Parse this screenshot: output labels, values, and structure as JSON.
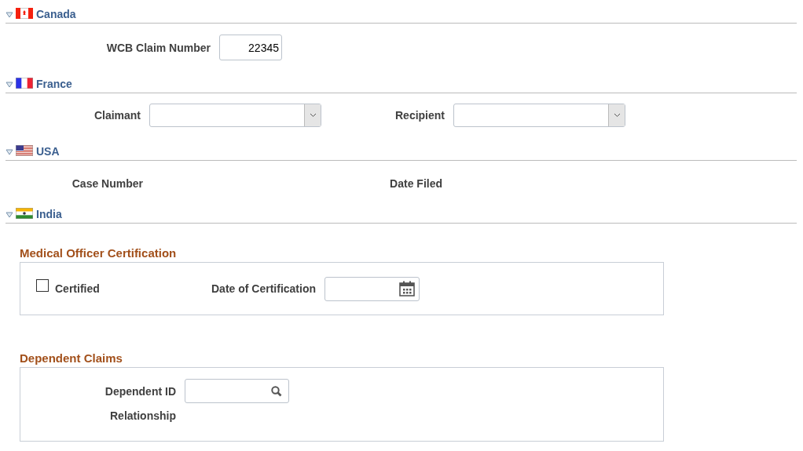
{
  "sections": [
    {
      "title": "Canada",
      "expanded": true,
      "fields": [
        {
          "kind": "text",
          "label": "WCB Claim Number",
          "value": "22345"
        }
      ]
    },
    {
      "title": "France",
      "expanded": true,
      "fields": [
        {
          "kind": "select",
          "label": "Claimant"
        },
        {
          "kind": "select",
          "label": "Recipient"
        }
      ]
    },
    {
      "title": "USA",
      "expanded": true,
      "fields": [
        {
          "kind": "display",
          "label": "Case Number"
        },
        {
          "kind": "display",
          "label": "Date Filed"
        }
      ]
    },
    {
      "title": "India",
      "expanded": true,
      "groups": [
        {
          "title": "Medical Officer Certification",
          "fields": [
            {
              "kind": "checkbox",
              "label": "Certified",
              "checked": false
            },
            {
              "kind": "date",
              "label": "Date of Certification"
            }
          ]
        },
        {
          "title": "Dependent Claims",
          "fields": [
            {
              "kind": "lookup",
              "label": "Dependent ID"
            },
            {
              "kind": "display",
              "label": "Relationship"
            }
          ]
        }
      ]
    }
  ]
}
